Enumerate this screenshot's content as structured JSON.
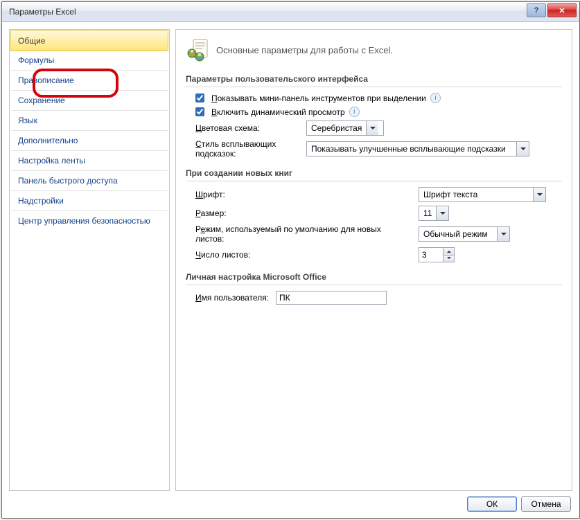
{
  "window": {
    "title": "Параметры Excel"
  },
  "sidebar": {
    "items": [
      "Общие",
      "Формулы",
      "Правописание",
      "Сохранение",
      "Язык",
      "Дополнительно",
      "Настройка ленты",
      "Панель быстрого доступа",
      "Надстройки",
      "Центр управления безопасностью"
    ]
  },
  "heading": "Основные параметры для работы с Excel.",
  "sections": {
    "ui": {
      "title": "Параметры пользовательского интерфейса",
      "miniToolbar": "Показывать мини-панель инструментов при выделении",
      "livePreview": "Включить динамический просмотр",
      "colorSchemeLabel": "Цветовая схема:",
      "colorSchemeValue": "Серебристая",
      "tooltipStyleLabel": "Стиль всплывающих подсказок:",
      "tooltipStyleValue": "Показывать улучшенные всплывающие подсказки"
    },
    "newbook": {
      "title": "При создании новых книг",
      "fontLabel": "Шрифт:",
      "fontValue": "Шрифт текста",
      "sizeLabel": "Размер:",
      "sizeValue": "11",
      "viewLabel": "Режим, используемый по умолчанию для новых листов:",
      "viewValue": "Обычный режим",
      "sheetsLabel": "Число листов:",
      "sheetsValue": "3"
    },
    "personalize": {
      "title": "Личная настройка Microsoft Office",
      "userLabel": "Имя пользователя:",
      "userValue": "ПК"
    }
  },
  "footer": {
    "ok": "ОК",
    "cancel": "Отмена"
  }
}
